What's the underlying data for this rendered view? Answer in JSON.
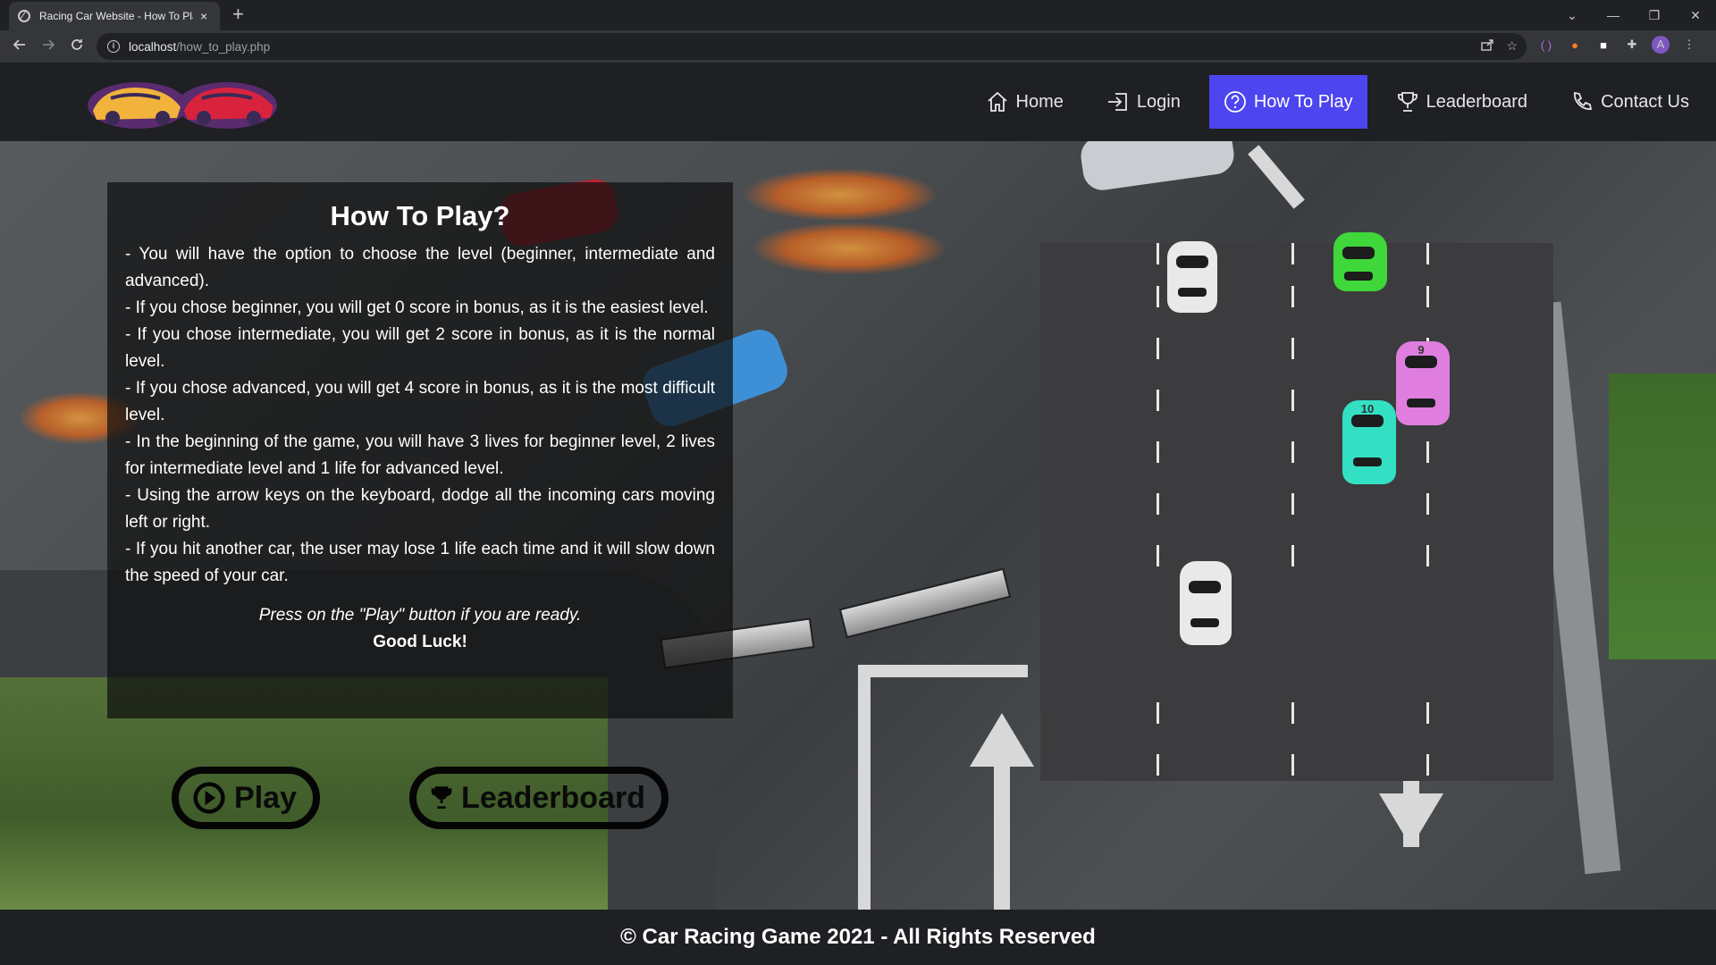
{
  "browser": {
    "tab_title": "Racing Car Website - How To Play",
    "tab_close": "×",
    "new_tab": "+",
    "url_host": "localhost",
    "url_path": "/how_to_play.php",
    "profile_initial": "A",
    "window_controls": [
      "⌄",
      "—",
      "❐",
      "✕"
    ],
    "nav_icons": [
      "back-icon",
      "forward-icon",
      "reload-icon"
    ],
    "extension_icons": [
      "share-icon",
      "star-icon",
      "extension-purple-icon",
      "extension-orange-icon",
      "extension-white-icon",
      "puzzle-icon"
    ]
  },
  "nav": {
    "items": [
      {
        "label": "Home",
        "icon": "home-icon"
      },
      {
        "label": "Login",
        "icon": "login-icon"
      },
      {
        "label": "How To Play",
        "icon": "question-icon",
        "active": true
      },
      {
        "label": "Leaderboard",
        "icon": "trophy-icon"
      },
      {
        "label": "Contact Us",
        "icon": "phone-icon"
      }
    ],
    "active_color": "#4c45f0"
  },
  "instructions": {
    "title": "How To Play?",
    "rules": [
      "- You will have the option to choose the level (beginner, intermediate and advanced).",
      "- If you chose beginner, you will get 0 score in bonus, as it is the easiest level.",
      "- If you chose intermediate, you will get 2 score in bonus, as it is the normal level.",
      "- If you chose advanced, you will get 4 score in bonus, as it is the most difficult level.",
      "- In the beginning of the game, you will have 3 lives for beginner level, 2 lives for intermediate level and 1 life for advanced level.",
      "- Using the arrow keys on the keyboard, dodge all the incoming cars moving left or right.",
      "- If you hit another car, the user may lose 1 life each time and it will slow down the speed of your car."
    ],
    "ready_note": "Press on the \"Play\" button if you are ready.",
    "good_luck": "Good Luck!"
  },
  "buttons": {
    "play": "Play",
    "leaderboard": "Leaderboard"
  },
  "game_preview": {
    "cars": [
      {
        "color": "#e9e9e9",
        "label": ""
      },
      {
        "color": "#3fd73a",
        "label": ""
      },
      {
        "color": "#e07ee0",
        "label": "9"
      },
      {
        "color": "#34e0c4",
        "label": "10"
      },
      {
        "color": "#e9e9e9",
        "label": ""
      }
    ]
  },
  "footer": {
    "text": "© Car Racing Game 2021 - All Rights Reserved"
  }
}
